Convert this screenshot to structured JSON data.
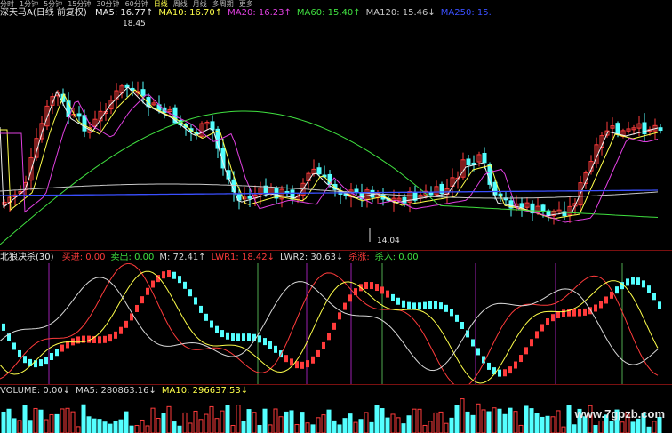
{
  "period_bar": {
    "items": [
      "分时",
      "1分钟",
      "5分钟",
      "15分钟",
      "30分钟",
      "60分钟",
      "日线",
      "周线",
      "月线",
      "多周期",
      "更多"
    ],
    "active": "日线"
  },
  "main_legend": {
    "title": "深天马A(日线 前复权)",
    "ma": [
      {
        "label": "MA5: 16.77↑",
        "color": "#f0f0f0"
      },
      {
        "label": "MA10: 16.70↑",
        "color": "#ffff4a"
      },
      {
        "label": "MA20: 16.23↑",
        "color": "#e040e0"
      },
      {
        "label": "MA60: 15.40↑",
        "color": "#40e040"
      },
      {
        "label": "MA120: 15.46↓",
        "color": "#c8c8c8"
      },
      {
        "label": "MA250: 15.",
        "color": "#3a4fff"
      }
    ]
  },
  "price_labels": {
    "high": "18.45",
    "low": "14.04"
  },
  "indicator_legend": {
    "title": "北狼决杀(30)",
    "items": [
      {
        "label": "买进: 0.00",
        "color": "#ff3b3b"
      },
      {
        "label": "卖出: 0.00",
        "color": "#40e040"
      },
      {
        "label": "M: 72.41↑",
        "color": "#d8d8d8"
      },
      {
        "label": "LWR1: 18.42↓",
        "color": "#ff3b3b"
      },
      {
        "label": "LWR2: 30.63↓",
        "color": "#d8d8d8"
      },
      {
        "label": "杀涨: ",
        "color": "#ff3b3b"
      },
      {
        "label": "杀入: 0.00",
        "color": "#40e040"
      }
    ]
  },
  "volume_legend": {
    "items": [
      {
        "label": "VOLUME: 0.00↓",
        "color": "#d8d8d8"
      },
      {
        "label": "MA5: 280863.16↓",
        "color": "#d8d8d8"
      },
      {
        "label": "MA10: 296637.53↓",
        "color": "#ffff4a"
      }
    ]
  },
  "watermark": "www.7gpzb.com",
  "colors": {
    "up": "#ff3b3b",
    "down": "#54ffff",
    "bg": "#000000",
    "ma250": "#3a4fff"
  }
}
